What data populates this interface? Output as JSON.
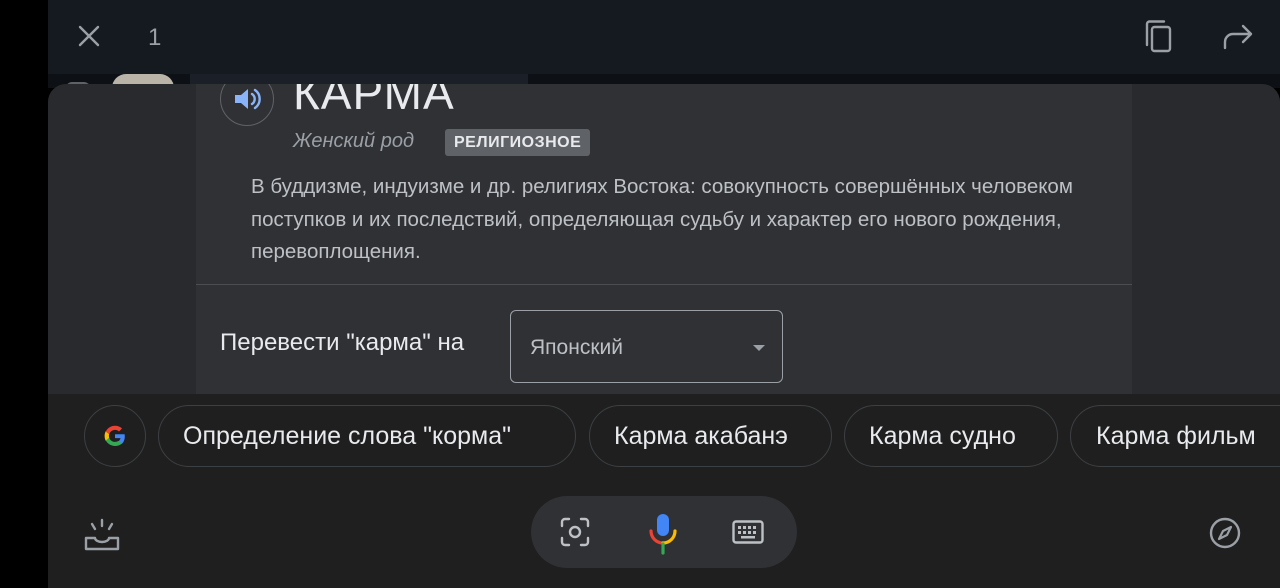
{
  "topbar": {
    "count": "1",
    "icons": [
      "close-icon",
      "copy-icon",
      "share-icon"
    ]
  },
  "card": {
    "word": "КАРМА",
    "gender": "Женский род",
    "tag": "РЕЛИГИОЗНОЕ",
    "definition": "В буддизме, индуизме и др. религиях Востока: совокупность совершённых человеком поступков и их последствий, определяющая судьбу и характер его нового рождения, перевоплощения.",
    "translate_label": "Перевести \"карма\" на",
    "language": "Японский"
  },
  "suggestions": [
    "Определение слова \"корма\"",
    "Карма акабанэ",
    "Карма судно",
    "Карма фильм"
  ],
  "colors": {
    "background": "#1f1f1f",
    "card": "#303134",
    "text": "#e8eaed",
    "muted": "#9aa0a6",
    "google_blue": "#4285F4",
    "google_red": "#EA4335",
    "google_yellow": "#FBBC05",
    "google_green": "#34A853"
  }
}
